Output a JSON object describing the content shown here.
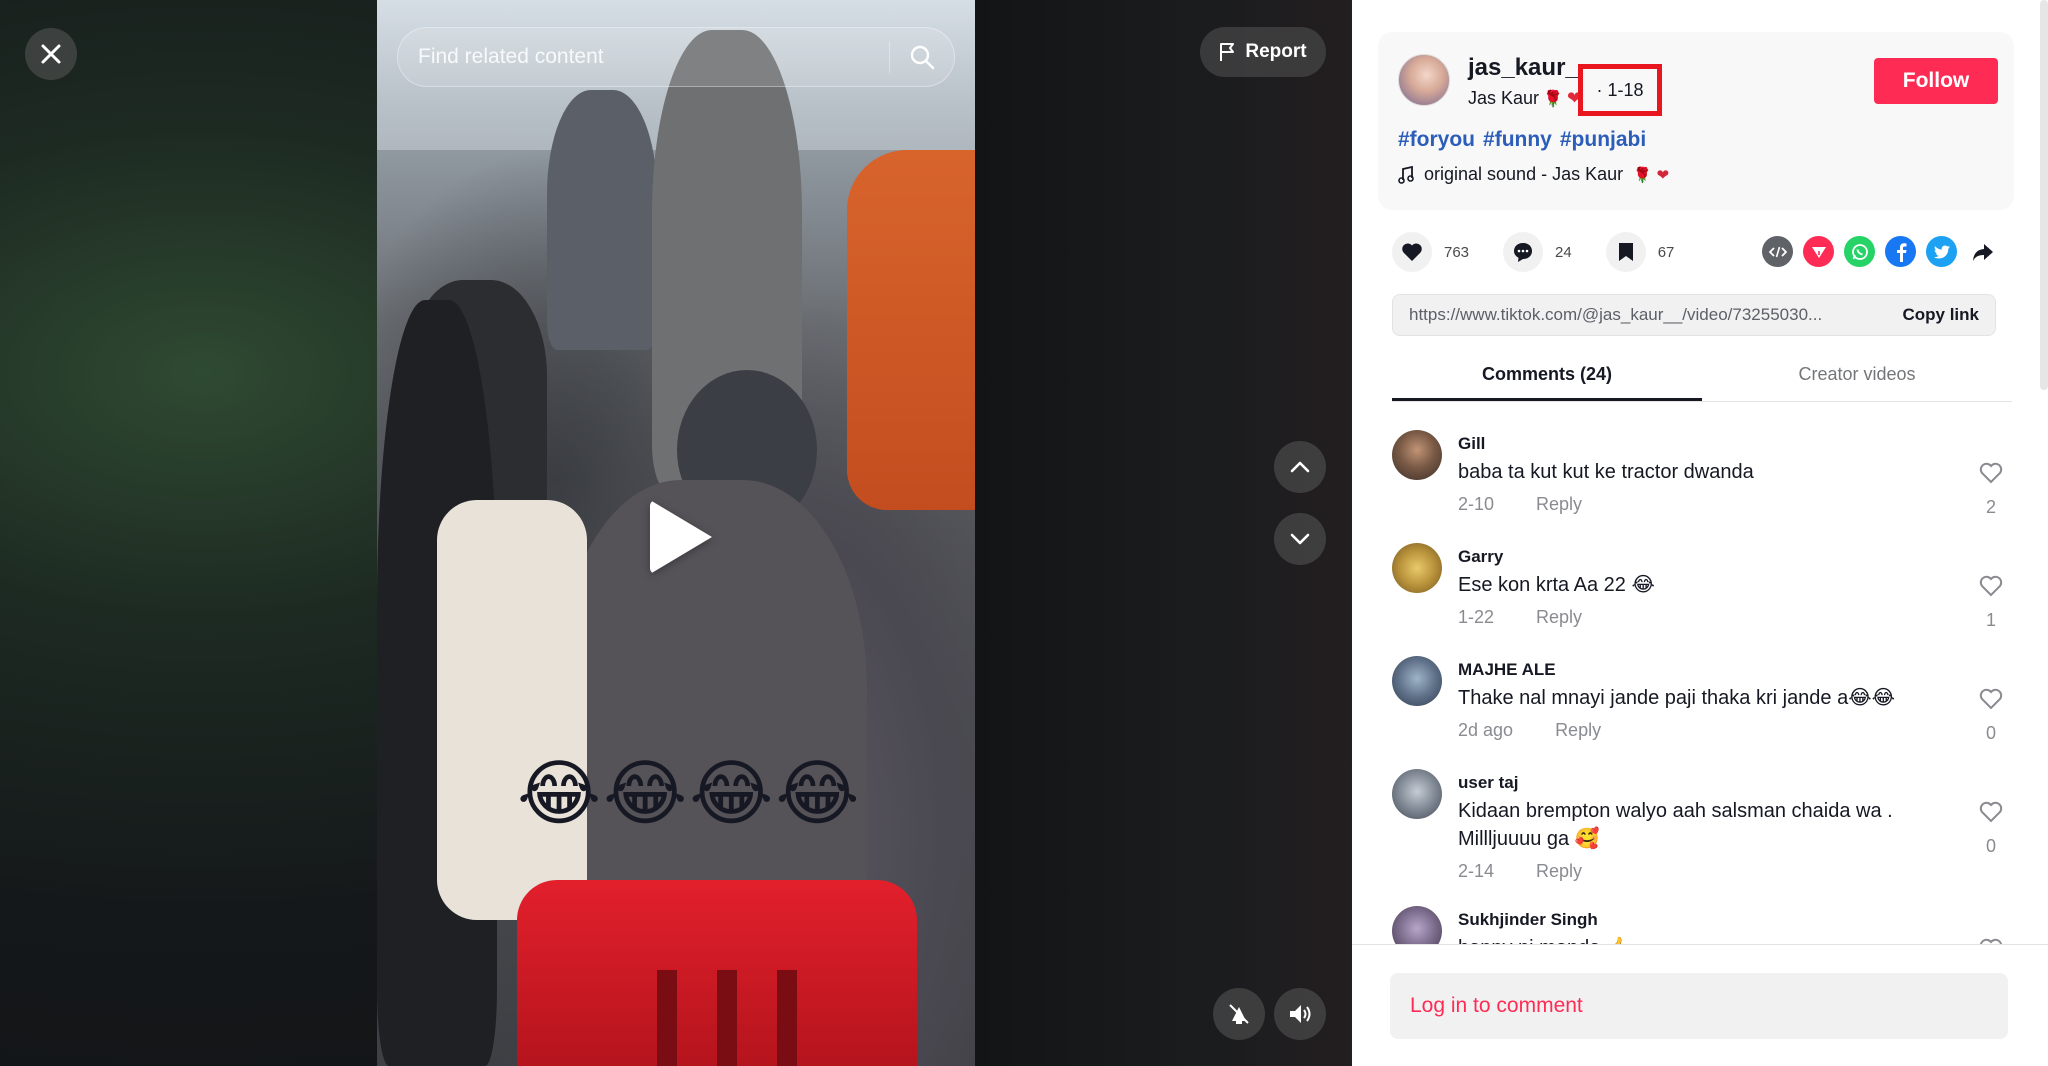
{
  "video": {
    "search_placeholder": "Find related content",
    "report_label": "Report",
    "overlay_emoji": "😂😂😂😂"
  },
  "author": {
    "username": "jas_kaur__",
    "nickname": "Jas Kaur",
    "nickname_emoji": "🌹",
    "date": "· 1-18",
    "follow_label": "Follow"
  },
  "hashtags": [
    "#foryou",
    "#funny",
    "#punjabi"
  ],
  "sound": {
    "label": "original sound - Jas Kaur",
    "emoji": "🌹 ❤"
  },
  "stats": {
    "likes": "763",
    "comments": "24",
    "saves": "67"
  },
  "share": {
    "url": "https://www.tiktok.com/@jas_kaur__/video/73255030...",
    "copy_label": "Copy link",
    "icons": [
      "embed-icon",
      "send-icon",
      "whatsapp-icon",
      "facebook-icon",
      "twitter-icon",
      "share-arrow-icon"
    ],
    "colors": {
      "embed": "#5f6368",
      "send": "#fe2c55",
      "whatsapp": "#25d366",
      "facebook": "#1877f2",
      "twitter": "#1da1f2"
    }
  },
  "tabs": [
    {
      "label": "Comments (24)",
      "active": true
    },
    {
      "label": "Creator videos",
      "active": false
    }
  ],
  "comments": [
    {
      "name": "Gill",
      "text": "baba ta kut kut ke tractor dwanda",
      "date": "2-10",
      "reply": "Reply",
      "likes": "2"
    },
    {
      "name": "Garry",
      "text": "Ese kon krta Aa 22 😂",
      "date": "1-22",
      "reply": "Reply",
      "likes": "1"
    },
    {
      "name": "MAJHE ALE",
      "text": "Thake nal mnayi jande paji thaka kri jande a😂😂",
      "date": "2d ago",
      "reply": "Reply",
      "likes": "0"
    },
    {
      "name": "user taj",
      "text": "Kidaan brempton walyo aah salsman chaida wa . Millljuuuu ga 🥰",
      "date": "2-14",
      "reply": "Reply",
      "likes": "0"
    },
    {
      "name": "Sukhjinder Singh",
      "text": "happy ni manda 👍",
      "date": "",
      "reply": "",
      "likes": ""
    }
  ],
  "login_prompt": "Log in to comment",
  "colors": {
    "accent": "#fe2c55",
    "hashtag": "#2b5db9",
    "highlight_box": "#e8161f"
  }
}
